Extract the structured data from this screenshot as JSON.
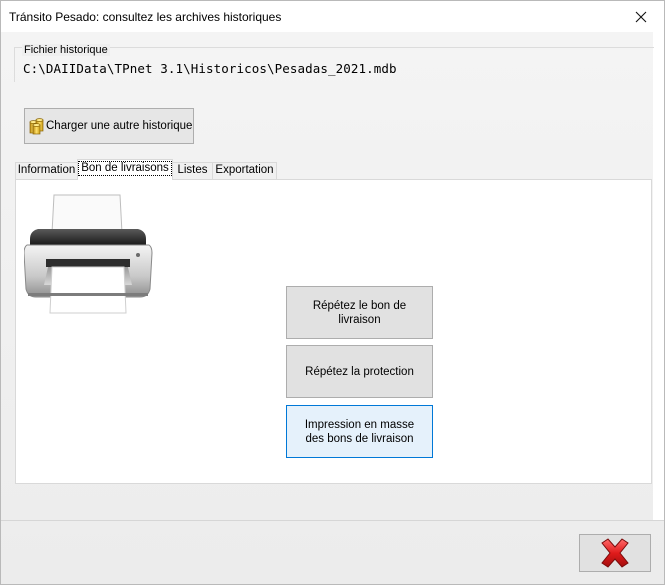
{
  "window": {
    "title": "Tránsito Pesado: consultez les archives historiques"
  },
  "history_file": {
    "group_label": "Fichier historique",
    "path": "C:\\DAIIData\\TPnet 3.1\\Historicos\\Pesadas_2021.mdb",
    "load_button_label": "Charger une autre historique"
  },
  "tabs": [
    {
      "label": "Information",
      "active": false
    },
    {
      "label": "Bon de livraisons",
      "active": true
    },
    {
      "label": "Listes",
      "active": false
    },
    {
      "label": "Exportation",
      "active": false
    }
  ],
  "panel": {
    "icon": "printer-icon",
    "buttons": [
      {
        "label": "Répétez le bon de livraison",
        "highlighted": false
      },
      {
        "label": "Répétez la protection",
        "highlighted": false
      },
      {
        "label": "Impression en masse des bons de livraison",
        "highlighted": true
      }
    ]
  },
  "footer": {
    "exit_icon": "red-x-icon"
  },
  "colors": {
    "accent_border": "#0078d7",
    "highlight_bg": "#e5f1fb",
    "exit_red": "#e01b1b"
  }
}
